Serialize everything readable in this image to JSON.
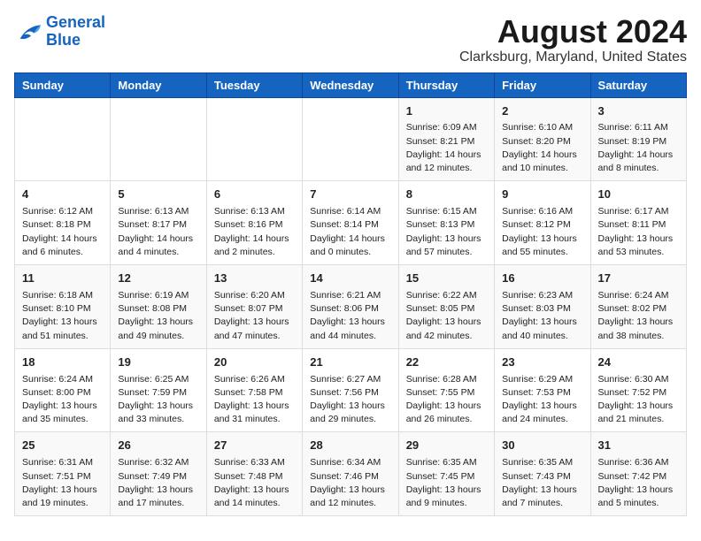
{
  "header": {
    "logo_line1": "General",
    "logo_line2": "Blue",
    "title": "August 2024",
    "subtitle": "Clarksburg, Maryland, United States"
  },
  "weekdays": [
    "Sunday",
    "Monday",
    "Tuesday",
    "Wednesday",
    "Thursday",
    "Friday",
    "Saturday"
  ],
  "weeks": [
    [
      {
        "day": "",
        "content": ""
      },
      {
        "day": "",
        "content": ""
      },
      {
        "day": "",
        "content": ""
      },
      {
        "day": "",
        "content": ""
      },
      {
        "day": "1",
        "content": "Sunrise: 6:09 AM\nSunset: 8:21 PM\nDaylight: 14 hours\nand 12 minutes."
      },
      {
        "day": "2",
        "content": "Sunrise: 6:10 AM\nSunset: 8:20 PM\nDaylight: 14 hours\nand 10 minutes."
      },
      {
        "day": "3",
        "content": "Sunrise: 6:11 AM\nSunset: 8:19 PM\nDaylight: 14 hours\nand 8 minutes."
      }
    ],
    [
      {
        "day": "4",
        "content": "Sunrise: 6:12 AM\nSunset: 8:18 PM\nDaylight: 14 hours\nand 6 minutes."
      },
      {
        "day": "5",
        "content": "Sunrise: 6:13 AM\nSunset: 8:17 PM\nDaylight: 14 hours\nand 4 minutes."
      },
      {
        "day": "6",
        "content": "Sunrise: 6:13 AM\nSunset: 8:16 PM\nDaylight: 14 hours\nand 2 minutes."
      },
      {
        "day": "7",
        "content": "Sunrise: 6:14 AM\nSunset: 8:14 PM\nDaylight: 14 hours\nand 0 minutes."
      },
      {
        "day": "8",
        "content": "Sunrise: 6:15 AM\nSunset: 8:13 PM\nDaylight: 13 hours\nand 57 minutes."
      },
      {
        "day": "9",
        "content": "Sunrise: 6:16 AM\nSunset: 8:12 PM\nDaylight: 13 hours\nand 55 minutes."
      },
      {
        "day": "10",
        "content": "Sunrise: 6:17 AM\nSunset: 8:11 PM\nDaylight: 13 hours\nand 53 minutes."
      }
    ],
    [
      {
        "day": "11",
        "content": "Sunrise: 6:18 AM\nSunset: 8:10 PM\nDaylight: 13 hours\nand 51 minutes."
      },
      {
        "day": "12",
        "content": "Sunrise: 6:19 AM\nSunset: 8:08 PM\nDaylight: 13 hours\nand 49 minutes."
      },
      {
        "day": "13",
        "content": "Sunrise: 6:20 AM\nSunset: 8:07 PM\nDaylight: 13 hours\nand 47 minutes."
      },
      {
        "day": "14",
        "content": "Sunrise: 6:21 AM\nSunset: 8:06 PM\nDaylight: 13 hours\nand 44 minutes."
      },
      {
        "day": "15",
        "content": "Sunrise: 6:22 AM\nSunset: 8:05 PM\nDaylight: 13 hours\nand 42 minutes."
      },
      {
        "day": "16",
        "content": "Sunrise: 6:23 AM\nSunset: 8:03 PM\nDaylight: 13 hours\nand 40 minutes."
      },
      {
        "day": "17",
        "content": "Sunrise: 6:24 AM\nSunset: 8:02 PM\nDaylight: 13 hours\nand 38 minutes."
      }
    ],
    [
      {
        "day": "18",
        "content": "Sunrise: 6:24 AM\nSunset: 8:00 PM\nDaylight: 13 hours\nand 35 minutes."
      },
      {
        "day": "19",
        "content": "Sunrise: 6:25 AM\nSunset: 7:59 PM\nDaylight: 13 hours\nand 33 minutes."
      },
      {
        "day": "20",
        "content": "Sunrise: 6:26 AM\nSunset: 7:58 PM\nDaylight: 13 hours\nand 31 minutes."
      },
      {
        "day": "21",
        "content": "Sunrise: 6:27 AM\nSunset: 7:56 PM\nDaylight: 13 hours\nand 29 minutes."
      },
      {
        "day": "22",
        "content": "Sunrise: 6:28 AM\nSunset: 7:55 PM\nDaylight: 13 hours\nand 26 minutes."
      },
      {
        "day": "23",
        "content": "Sunrise: 6:29 AM\nSunset: 7:53 PM\nDaylight: 13 hours\nand 24 minutes."
      },
      {
        "day": "24",
        "content": "Sunrise: 6:30 AM\nSunset: 7:52 PM\nDaylight: 13 hours\nand 21 minutes."
      }
    ],
    [
      {
        "day": "25",
        "content": "Sunrise: 6:31 AM\nSunset: 7:51 PM\nDaylight: 13 hours\nand 19 minutes."
      },
      {
        "day": "26",
        "content": "Sunrise: 6:32 AM\nSunset: 7:49 PM\nDaylight: 13 hours\nand 17 minutes."
      },
      {
        "day": "27",
        "content": "Sunrise: 6:33 AM\nSunset: 7:48 PM\nDaylight: 13 hours\nand 14 minutes."
      },
      {
        "day": "28",
        "content": "Sunrise: 6:34 AM\nSunset: 7:46 PM\nDaylight: 13 hours\nand 12 minutes."
      },
      {
        "day": "29",
        "content": "Sunrise: 6:35 AM\nSunset: 7:45 PM\nDaylight: 13 hours\nand 9 minutes."
      },
      {
        "day": "30",
        "content": "Sunrise: 6:35 AM\nSunset: 7:43 PM\nDaylight: 13 hours\nand 7 minutes."
      },
      {
        "day": "31",
        "content": "Sunrise: 6:36 AM\nSunset: 7:42 PM\nDaylight: 13 hours\nand 5 minutes."
      }
    ]
  ]
}
